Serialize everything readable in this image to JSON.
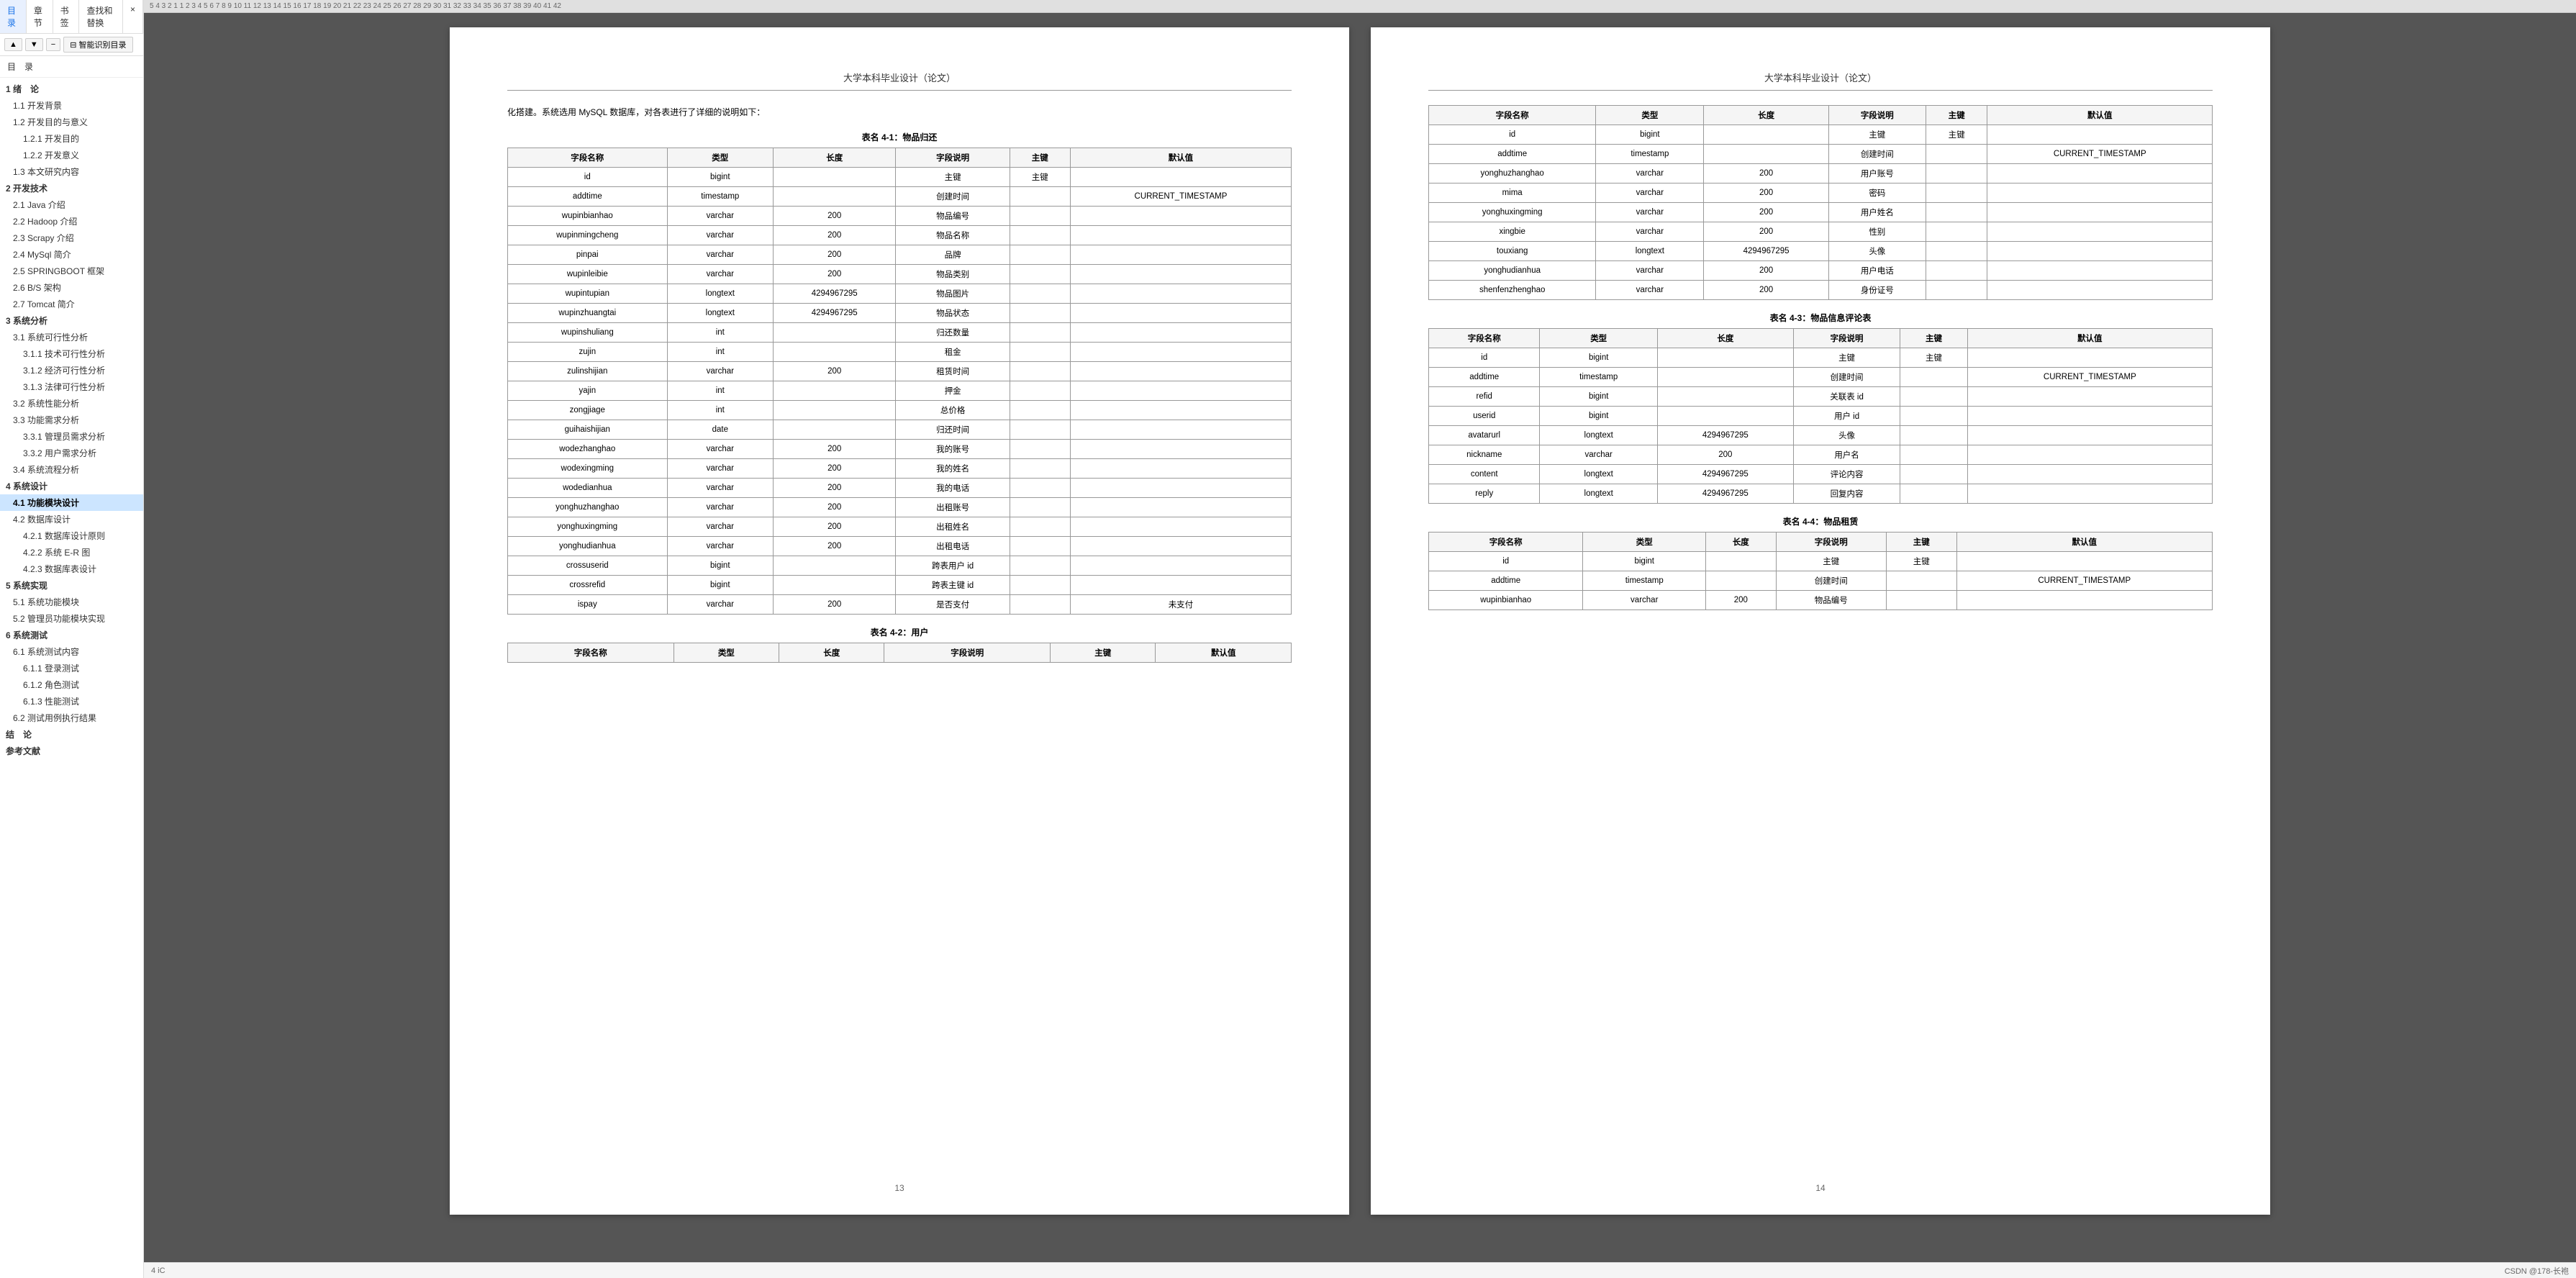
{
  "sidebar": {
    "tabs": [
      "目录",
      "章节",
      "书签",
      "查找和替换",
      "×"
    ],
    "active_tab": "目录",
    "toolbar": {
      "up_label": "▲",
      "down_label": "▼",
      "minus_label": "−",
      "smart_toc_label": "⊟ 智能识别目录"
    },
    "toc_label": "目　录",
    "items": [
      {
        "label": "1 绪　论",
        "level": "level1",
        "active": false
      },
      {
        "label": "1.1 开发背景",
        "level": "level2",
        "active": false
      },
      {
        "label": "1.2 开发目的与意义",
        "level": "level2",
        "active": false
      },
      {
        "label": "1.2.1 开发目的",
        "level": "level3",
        "active": false
      },
      {
        "label": "1.2.2 开发意义",
        "level": "level3",
        "active": false
      },
      {
        "label": "1.3 本文研究内容",
        "level": "level2",
        "active": false
      },
      {
        "label": "2 开发技术",
        "level": "level1",
        "active": false
      },
      {
        "label": "2.1 Java 介绍",
        "level": "level2",
        "active": false
      },
      {
        "label": "2.2 Hadoop 介绍",
        "level": "level2",
        "active": false
      },
      {
        "label": "2.3 Scrapy 介绍",
        "level": "level2",
        "active": false
      },
      {
        "label": "2.4 MySql 简介",
        "level": "level2",
        "active": false
      },
      {
        "label": "2.5 SPRINGBOOT 框架",
        "level": "level2",
        "active": false
      },
      {
        "label": "2.6 B/S 架构",
        "level": "level2",
        "active": false
      },
      {
        "label": "2.7 Tomcat 简介",
        "level": "level2",
        "active": false
      },
      {
        "label": "3 系统分析",
        "level": "level1",
        "active": false
      },
      {
        "label": "3.1 系统可行性分析",
        "level": "level2",
        "active": false
      },
      {
        "label": "3.1.1 技术可行性分析",
        "level": "level3",
        "active": false
      },
      {
        "label": "3.1.2 经济可行性分析",
        "level": "level3",
        "active": false
      },
      {
        "label": "3.1.3 法律可行性分析",
        "level": "level3",
        "active": false
      },
      {
        "label": "3.2 系统性能分析",
        "level": "level2",
        "active": false
      },
      {
        "label": "3.3 功能需求分析",
        "level": "level2",
        "active": false
      },
      {
        "label": "3.3.1 管理员需求分析",
        "level": "level3",
        "active": false
      },
      {
        "label": "3.3.2 用户需求分析",
        "level": "level3",
        "active": false
      },
      {
        "label": "3.4 系统流程分析",
        "level": "level2",
        "active": false
      },
      {
        "label": "4 系统设计",
        "level": "level1",
        "active": false
      },
      {
        "label": "4.1 功能模块设计",
        "level": "level2",
        "active": true
      },
      {
        "label": "4.2 数据库设计",
        "level": "level2",
        "active": false
      },
      {
        "label": "4.2.1 数据库设计原则",
        "level": "level3",
        "active": false
      },
      {
        "label": "4.2.2 系统 E-R 图",
        "level": "level3",
        "active": false
      },
      {
        "label": "4.2.3 数据库表设计",
        "level": "level3",
        "active": false
      },
      {
        "label": "5 系统实现",
        "level": "level1",
        "active": false
      },
      {
        "label": "5.1  系统功能模块",
        "level": "level2",
        "active": false
      },
      {
        "label": "5.2  管理员功能模块实现",
        "level": "level2",
        "active": false
      },
      {
        "label": "6 系统测试",
        "level": "level1",
        "active": false
      },
      {
        "label": "6.1 系统测试内容",
        "level": "level2",
        "active": false
      },
      {
        "label": "6.1.1 登录测试",
        "level": "level3",
        "active": false
      },
      {
        "label": "6.1.2 角色测试",
        "level": "level3",
        "active": false
      },
      {
        "label": "6.1.3  性能测试",
        "level": "level3",
        "active": false
      },
      {
        "label": "6.2 测试用例执行结果",
        "level": "level2",
        "active": false
      },
      {
        "label": "结　论",
        "level": "level1",
        "active": false
      },
      {
        "label": "参考文献",
        "level": "level1",
        "active": false
      }
    ]
  },
  "ruler": {
    "numbers": "5  4  3  2  1    1  2  3  4  5  6  7  8  9  10 11 12 13 14 15 16 17 18 19 20 21 22 23 24 25 26 27 28 29 30 31 32 33 34 35 36 37 38 39 40 41 42"
  },
  "page_left": {
    "header": "大学本科毕业设计（论文）",
    "body_text": "化搭建。系统选用 MySQL 数据库，对各表进行了详细的说明如下：",
    "table1": {
      "caption": "表名 4-1：物品归还",
      "headers": [
        "字段名称",
        "类型",
        "长度",
        "字段说明",
        "主键",
        "默认值"
      ],
      "rows": [
        [
          "id",
          "bigint",
          "",
          "主键",
          "主键",
          ""
        ],
        [
          "addtime",
          "timestamp",
          "",
          "创建时间",
          "",
          "CURRENT_TIMESTAMP"
        ],
        [
          "wupinbianhao",
          "varchar",
          "200",
          "物品编号",
          "",
          ""
        ],
        [
          "wupinmingcheng",
          "varchar",
          "200",
          "物品名称",
          "",
          ""
        ],
        [
          "pinpai",
          "varchar",
          "200",
          "品牌",
          "",
          ""
        ],
        [
          "wupinleibie",
          "varchar",
          "200",
          "物品类别",
          "",
          ""
        ],
        [
          "wupintupian",
          "longtext",
          "4294967295",
          "物品图片",
          "",
          ""
        ],
        [
          "wupinzhuangtai",
          "longtext",
          "4294967295",
          "物品状态",
          "",
          ""
        ],
        [
          "wupinshuliang",
          "int",
          "",
          "归还数量",
          "",
          ""
        ],
        [
          "zujin",
          "int",
          "",
          "租金",
          "",
          ""
        ],
        [
          "zulinshijian",
          "varchar",
          "200",
          "租赁时间",
          "",
          ""
        ],
        [
          "yajin",
          "int",
          "",
          "押金",
          "",
          ""
        ],
        [
          "zongjiage",
          "int",
          "",
          "总价格",
          "",
          ""
        ],
        [
          "guihaishijian",
          "date",
          "",
          "归还时间",
          "",
          ""
        ],
        [
          "wodezhanghao",
          "varchar",
          "200",
          "我的账号",
          "",
          ""
        ],
        [
          "wodexingming",
          "varchar",
          "200",
          "我的姓名",
          "",
          ""
        ],
        [
          "wodedianhua",
          "varchar",
          "200",
          "我的电话",
          "",
          ""
        ],
        [
          "yonghuzhanghao",
          "varchar",
          "200",
          "出租账号",
          "",
          ""
        ],
        [
          "yonghuxingming",
          "varchar",
          "200",
          "出租姓名",
          "",
          ""
        ],
        [
          "yonghudianhua",
          "varchar",
          "200",
          "出租电话",
          "",
          ""
        ],
        [
          "crossuserid",
          "bigint",
          "",
          "跨表用户 id",
          "",
          ""
        ],
        [
          "crossrefid",
          "bigint",
          "",
          "跨表主键 id",
          "",
          ""
        ],
        [
          "ispay",
          "varchar",
          "200",
          "是否支付",
          "",
          "未支付"
        ]
      ]
    },
    "table2": {
      "caption": "表名 4-2：用户",
      "headers": [
        "字段名称",
        "类型",
        "长度",
        "字段说明",
        "主键",
        "默认值"
      ],
      "rows": []
    },
    "footer": "13"
  },
  "page_right": {
    "header": "大学本科毕业设计（论文）",
    "table_user": {
      "rows": [
        [
          "id",
          "bigint",
          "",
          "主键",
          "主键",
          ""
        ],
        [
          "addtime",
          "timestamp",
          "",
          "创建时间",
          "",
          "CURRENT_TIMESTAMP"
        ],
        [
          "yonghuzhanghao",
          "varchar",
          "200",
          "用户账号",
          "",
          ""
        ],
        [
          "mima",
          "varchar",
          "200",
          "密码",
          "",
          ""
        ],
        [
          "yonghuxingming",
          "varchar",
          "200",
          "用户姓名",
          "",
          ""
        ],
        [
          "xingbie",
          "varchar",
          "200",
          "性别",
          "",
          ""
        ],
        [
          "touxiang",
          "longtext",
          "4294967295",
          "头像",
          "",
          ""
        ],
        [
          "yonghudianhua",
          "varchar",
          "200",
          "用户电话",
          "",
          ""
        ],
        [
          "shenfenzhenghao",
          "varchar",
          "200",
          "身份证号",
          "",
          ""
        ]
      ]
    },
    "table3": {
      "caption": "表名 4-3：物品信息评论表",
      "headers": [
        "字段名称",
        "类型",
        "长度",
        "字段说明",
        "主键",
        "默认值"
      ],
      "rows": [
        [
          "id",
          "bigint",
          "",
          "主键",
          "主键",
          ""
        ],
        [
          "addtime",
          "timestamp",
          "",
          "创建时间",
          "",
          "CURRENT_TIMESTAMP"
        ],
        [
          "refid",
          "bigint",
          "",
          "关联表 id",
          "",
          ""
        ],
        [
          "userid",
          "bigint",
          "",
          "用户 id",
          "",
          ""
        ],
        [
          "avatarurl",
          "longtext",
          "4294967295",
          "头像",
          "",
          ""
        ],
        [
          "nickname",
          "varchar",
          "200",
          "用户名",
          "",
          ""
        ],
        [
          "content",
          "longtext",
          "4294967295",
          "评论内容",
          "",
          ""
        ],
        [
          "reply",
          "longtext",
          "4294967295",
          "回复内容",
          "",
          ""
        ]
      ]
    },
    "table4": {
      "caption": "表名 4-4：物品租赁",
      "headers": [
        "字段名称",
        "类型",
        "长度",
        "字段说明",
        "主键",
        "默认值"
      ],
      "rows": [
        [
          "id",
          "bigint",
          "",
          "主键",
          "主键",
          ""
        ],
        [
          "addtime",
          "timestamp",
          "",
          "创建时间",
          "",
          "CURRENT_TIMESTAMP"
        ],
        [
          "wupinbianhao",
          "varchar",
          "200",
          "物品编号",
          "",
          ""
        ]
      ]
    },
    "footer": "14"
  },
  "status_bar": {
    "text": "4 iC",
    "info": "CSDN @178-长袍"
  }
}
